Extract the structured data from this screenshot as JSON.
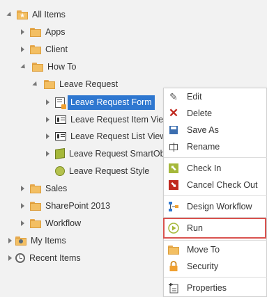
{
  "tree": {
    "all_items": "All Items",
    "apps": "Apps",
    "client": "Client",
    "how_to": "How To",
    "leave_request": "Leave Request",
    "children": [
      "Leave Request Form",
      "Leave Request Item View",
      "Leave Request List View",
      "Leave Request SmartObject",
      "Leave Request Style"
    ],
    "sales": "Sales",
    "sharepoint": "SharePoint 2013",
    "workflow": "Workflow",
    "my_items": "My Items",
    "recent_items": "Recent Items"
  },
  "menu": {
    "edit": "Edit",
    "delete": "Delete",
    "save_as": "Save As",
    "rename": "Rename",
    "check_in": "Check In",
    "cancel_check_out": "Cancel Check Out",
    "design_workflow": "Design Workflow",
    "run": "Run",
    "move_to": "Move To",
    "security": "Security",
    "properties": "Properties"
  },
  "colors": {
    "selection": "#2e77d0",
    "run_highlight": "#d9534f",
    "folder": "#f3bf63"
  }
}
